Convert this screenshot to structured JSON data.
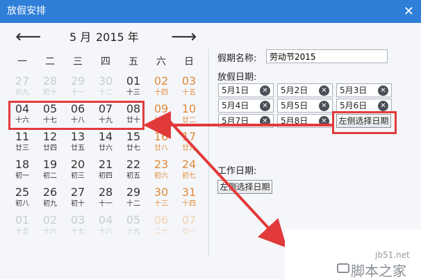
{
  "window": {
    "title": "放假安排",
    "close_glyph": "✕"
  },
  "calendar": {
    "month_label": "5 月",
    "year_label": "2015 年",
    "prev_glyph": "⟵",
    "next_glyph": "⟶",
    "weekdays": [
      "一",
      "二",
      "三",
      "四",
      "五",
      "六",
      "日"
    ],
    "weeks": [
      [
        [
          "27",
          "初九",
          "dim"
        ],
        [
          "28",
          "初十",
          "dim"
        ],
        [
          "29",
          "十一",
          "dim"
        ],
        [
          "30",
          "十二",
          "dim"
        ],
        [
          "01",
          "十三",
          ""
        ],
        [
          "02",
          "十四",
          "w"
        ],
        [
          "03",
          "十五",
          "w"
        ]
      ],
      [
        [
          "04",
          "十六",
          ""
        ],
        [
          "05",
          "十七",
          ""
        ],
        [
          "06",
          "十八",
          ""
        ],
        [
          "07",
          "十九",
          ""
        ],
        [
          "08",
          "廿十",
          ""
        ],
        [
          "09",
          "廿一",
          "w"
        ],
        [
          "10",
          "廿二",
          "w"
        ]
      ],
      [
        [
          "11",
          "廿三",
          ""
        ],
        [
          "12",
          "廿四",
          ""
        ],
        [
          "13",
          "廿五",
          ""
        ],
        [
          "14",
          "廿六",
          ""
        ],
        [
          "15",
          "廿七",
          ""
        ],
        [
          "16",
          "廿八",
          "w"
        ],
        [
          "17",
          "廿九",
          "w"
        ]
      ],
      [
        [
          "18",
          "初一",
          ""
        ],
        [
          "19",
          "初二",
          ""
        ],
        [
          "20",
          "初三",
          ""
        ],
        [
          "21",
          "初四",
          ""
        ],
        [
          "22",
          "初五",
          ""
        ],
        [
          "23",
          "初六",
          "w"
        ],
        [
          "24",
          "初七",
          "w"
        ]
      ],
      [
        [
          "25",
          "初八",
          ""
        ],
        [
          "26",
          "初九",
          ""
        ],
        [
          "27",
          "初十",
          ""
        ],
        [
          "28",
          "十一",
          ""
        ],
        [
          "29",
          "十二",
          ""
        ],
        [
          "30",
          "十三",
          "w"
        ],
        [
          "31",
          "十四",
          "w"
        ]
      ],
      [
        [
          "01",
          "十五",
          "dim"
        ],
        [
          "02",
          "十六",
          "dim"
        ],
        [
          "03",
          "十七",
          "dim"
        ],
        [
          "04",
          "十八",
          "dim"
        ],
        [
          "05",
          "十九",
          "dim"
        ],
        [
          "06",
          "二十",
          "wdim"
        ],
        [
          "07",
          "廿一",
          "wdim"
        ]
      ]
    ]
  },
  "form": {
    "holiday_name_label": "假期名称:",
    "holiday_name_value": "劳动节2015",
    "holiday_dates_label": "放假日期:",
    "holiday_dates": [
      "5月1日",
      "5月2日",
      "5月3日",
      "5月4日",
      "5月5日",
      "5月6日",
      "5月7日",
      "5月8日"
    ],
    "select_left_button": "左侧选择日期",
    "work_dates_label": "工作日期:",
    "work_select_button": "左侧选择日期"
  },
  "watermark": {
    "site": "jb51.net",
    "brand": "脚本之家"
  },
  "colors": {
    "titlebar": "#2f7fd8",
    "weekend": "#e08a3a",
    "annotation": "#e23a3a"
  }
}
